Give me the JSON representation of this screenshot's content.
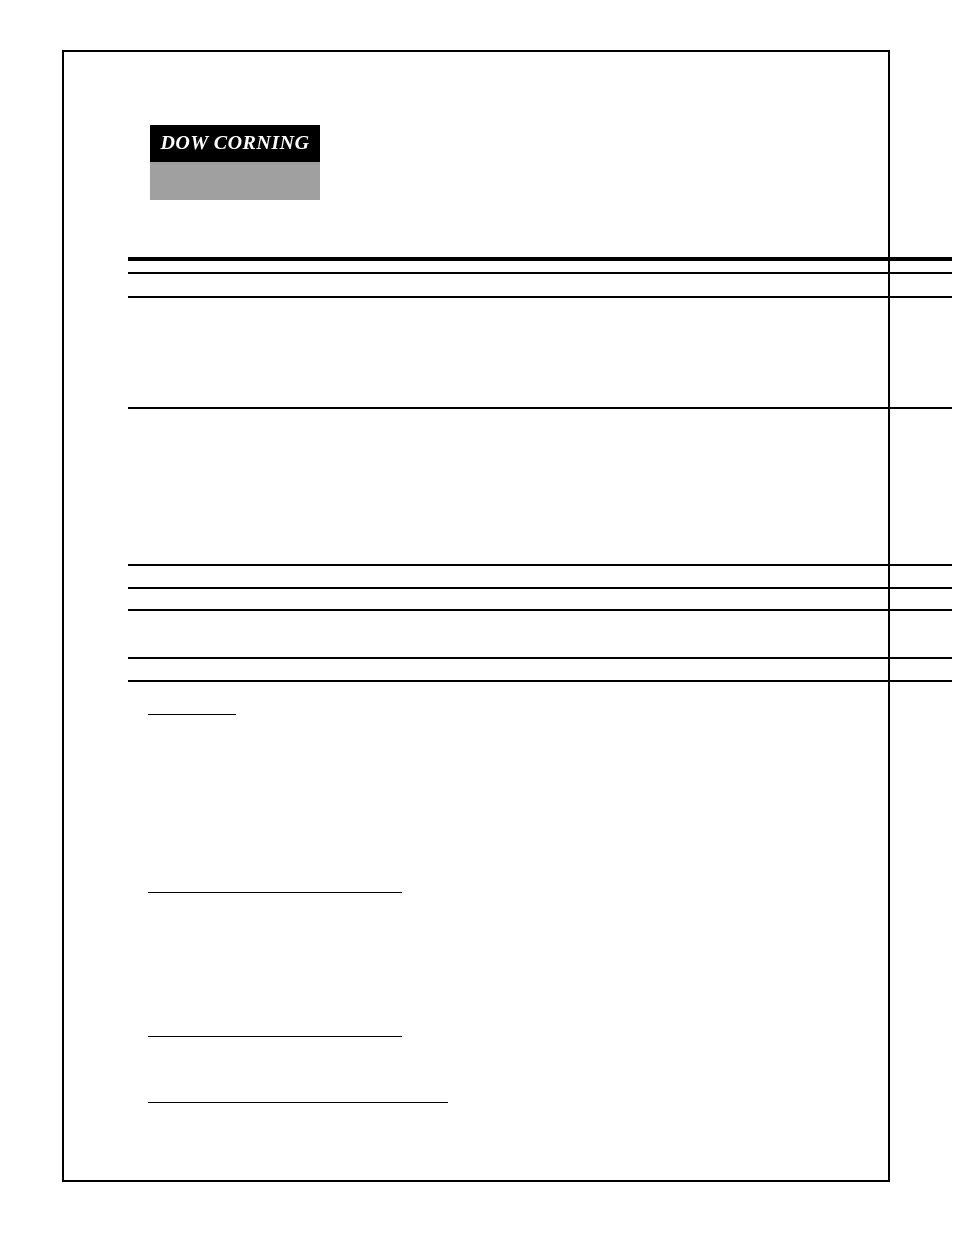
{
  "logo": {
    "text": "DOW CORNING"
  }
}
